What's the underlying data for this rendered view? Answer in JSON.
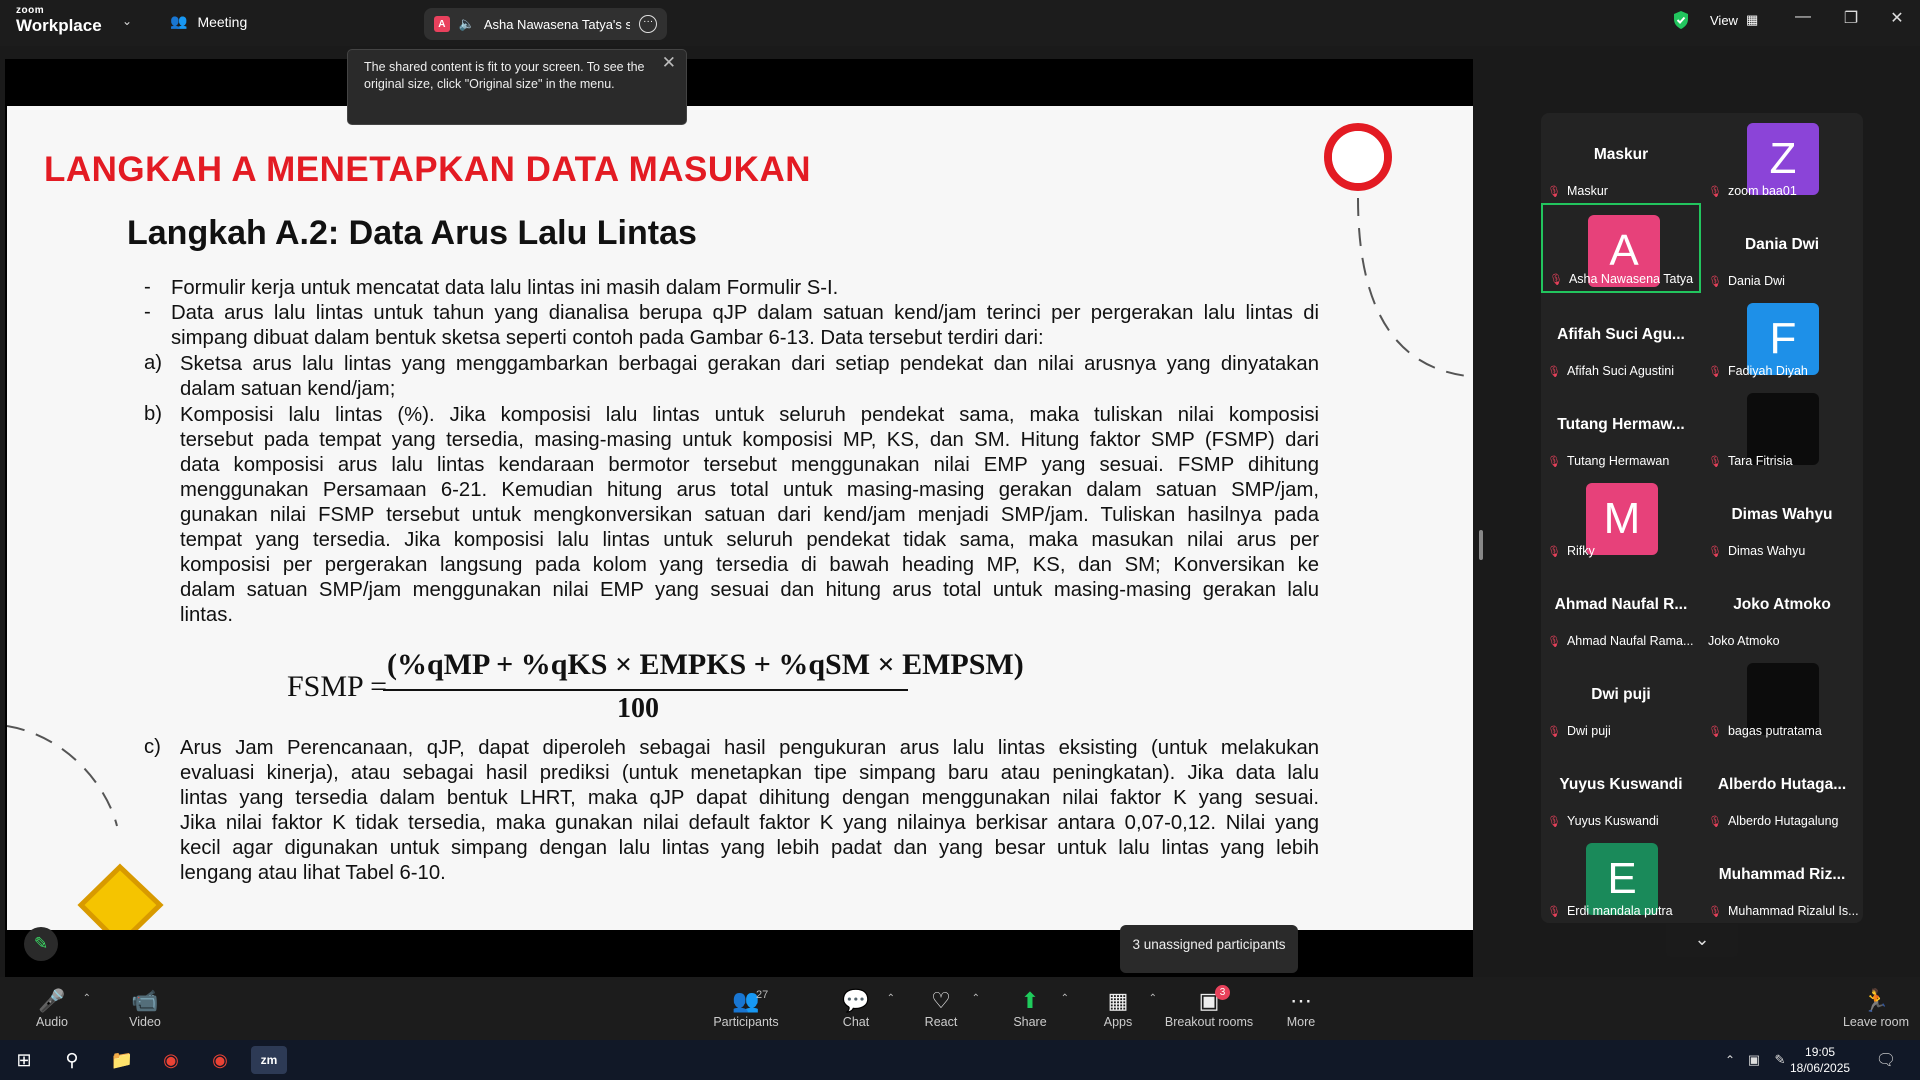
{
  "app": {
    "brand_top": "zoom",
    "brand_bottom": "Workplace",
    "meeting_label": "Meeting",
    "share_tab_badge": "A",
    "share_tab_label": "Asha Nawasena Tatya's screen",
    "view_label": "View"
  },
  "tooltip": {
    "text": "The shared content is fit to your screen. To see the original size, click \"Original size\" in the menu."
  },
  "slide": {
    "title": "LANGKAH A MENETAPKAN DATA MASUKAN",
    "subtitle": "Langkah A.2: Data Arus Lalu Lintas",
    "bullets": [
      {
        "marker": "-",
        "lines": [
          "Formulir kerja untuk mencatat data lalu lintas ini masih dalam Formulir S-I."
        ]
      },
      {
        "marker": "-",
        "lines": [
          "Data arus lalu lintas untuk tahun yang dianalisa berupa qJP dalam satuan kend/jam terinci per pergerakan lalu lintas di",
          "simpang dibuat dalam bentuk sketsa seperti contoh pada Gambar 6-13. Data tersebut terdiri dari:"
        ]
      }
    ],
    "items": [
      {
        "marker": "a)",
        "lines": [
          "Sketsa arus lalu lintas yang menggambarkan berbagai gerakan dari setiap pendekat dan nilai arusnya yang dinyatakan",
          "dalam satuan kend/jam;"
        ]
      },
      {
        "marker": "b)",
        "lines": [
          "Komposisi lalu lintas (%). Jika komposisi lalu lintas untuk seluruh pendekat sama, maka tuliskan nilai komposisi",
          "tersebut pada tempat yang tersedia, masing-masing untuk komposisi MP, KS, dan SM. Hitung faktor SMP (FSMP) dari",
          "data komposisi arus lalu lintas kendaraan bermotor tersebut menggunakan nilai EMP yang sesuai. FSMP dihitung",
          "menggunakan Persamaan 6-21. Kemudian hitung arus total untuk masing-masing gerakan dalam satuan SMP/jam,",
          "gunakan nilai FSMP tersebut untuk mengkonversikan satuan dari kend/jam menjadi SMP/jam. Tuliskan hasilnya pada",
          "tempat yang tersedia. Jika komposisi lalu lintas untuk seluruh pendekat tidak sama, maka masukan nilai arus per",
          "komposisi per pergerakan langsung pada kolom yang tersedia di bawah heading MP, KS, dan SM; Konversikan ke",
          "dalam satuan SMP/jam menggunakan nilai EMP yang sesuai dan hitung arus total untuk masing-masing gerakan lalu",
          "lintas."
        ]
      },
      {
        "marker": "c)",
        "lines": [
          "Arus Jam Perencanaan, qJP, dapat diperoleh sebagai hasil pengukuran arus lalu lintas eksisting (untuk melakukan",
          "evaluasi kinerja), atau sebagai hasil prediksi (untuk menetapkan tipe simpang baru atau peningkatan). Jika data lalu",
          "lintas yang tersedia dalam bentuk LHRT, maka qJP dapat dihitung dengan menggunakan nilai faktor K yang sesuai.",
          "Jika nilai faktor K tidak tersedia, maka gunakan nilai default faktor K yang nilainya berkisar antara 0,07-0,12. Nilai yang",
          "kecil agar digunakan untuk simpang dengan lalu lintas yang lebih padat dan yang besar untuk lalu lintas yang lebih",
          "lengang atau lihat Tabel 6-10."
        ]
      }
    ],
    "formula": {
      "lhs": "FSMP =",
      "numerator": "(%qMP + %qKS × EMPKS + %qSM × EMPSM)",
      "denominator": "100"
    }
  },
  "participants_gallery": [
    {
      "display": "Maskur",
      "name": "Maskur",
      "avatar_letter": "",
      "avatar_color": ""
    },
    {
      "display": "",
      "name": "zoom baa01",
      "avatar_letter": "Z",
      "avatar_color": "#8b44d8"
    },
    {
      "display": "",
      "name": "Asha Nawasena Tatya",
      "avatar_letter": "A",
      "avatar_color": "#e7417a",
      "active": true
    },
    {
      "display": "Dania Dwi",
      "name": "Dania Dwi",
      "avatar_letter": "",
      "avatar_color": ""
    },
    {
      "display": "Afifah Suci Agu...",
      "name": "Afifah Suci Agustini",
      "avatar_letter": "",
      "avatar_color": ""
    },
    {
      "display": "",
      "name": "Fadiyah Diyah",
      "avatar_letter": "F",
      "avatar_color": "#1e90e8"
    },
    {
      "display": "Tutang  Hermaw...",
      "name": "Tutang Hermawan",
      "avatar_letter": "",
      "avatar_color": ""
    },
    {
      "display": "",
      "name": "Tara Fitrisia",
      "avatar_letter": "",
      "avatar_color": "#0c0c0c"
    },
    {
      "display": "",
      "name": "Rifky",
      "avatar_letter": "M",
      "avatar_color": "#e7417a"
    },
    {
      "display": "Dimas Wahyu",
      "name": "Dimas Wahyu",
      "avatar_letter": "",
      "avatar_color": ""
    },
    {
      "display": "Ahmad Naufal R...",
      "name": "Ahmad Naufal Rama...",
      "avatar_letter": "",
      "avatar_color": ""
    },
    {
      "display": "Joko Atmoko",
      "name": "Joko Atmoko",
      "avatar_letter": "",
      "avatar_color": "",
      "unmuted": true
    },
    {
      "display": "Dwi puji",
      "name": "Dwi puji",
      "avatar_letter": "",
      "avatar_color": ""
    },
    {
      "display": "",
      "name": "bagas putratama",
      "avatar_letter": "",
      "avatar_color": "#0c0c0c"
    },
    {
      "display": "Yuyus Kuswandi",
      "name": "Yuyus Kuswandi",
      "avatar_letter": "",
      "avatar_color": ""
    },
    {
      "display": "Alberdo  Hutaga...",
      "name": "Alberdo Hutagalung",
      "avatar_letter": "",
      "avatar_color": ""
    },
    {
      "display": "",
      "name": "Erdi mandala putra",
      "avatar_letter": "E",
      "avatar_color": "#1a8a5a"
    },
    {
      "display": "Muhammad  Riz...",
      "name": "Muhammad Rizalul Is...",
      "avatar_letter": "",
      "avatar_color": ""
    }
  ],
  "unassigned": "3 unassigned participants",
  "toolbar": {
    "audio": "Audio",
    "video": "Video",
    "participants": "Participants",
    "participants_count": "27",
    "chat": "Chat",
    "react": "React",
    "share": "Share",
    "apps": "Apps",
    "breakout": "Breakout rooms",
    "breakout_badge": "3",
    "more": "More",
    "leave": "Leave room"
  },
  "taskbar": {
    "time": "19:05",
    "date": "18/06/2025"
  },
  "colors": {
    "accent_red": "#e31b23",
    "active_green": "#22c55e",
    "share_green": "#1fcb5c",
    "mute_red": "#e8415b"
  }
}
